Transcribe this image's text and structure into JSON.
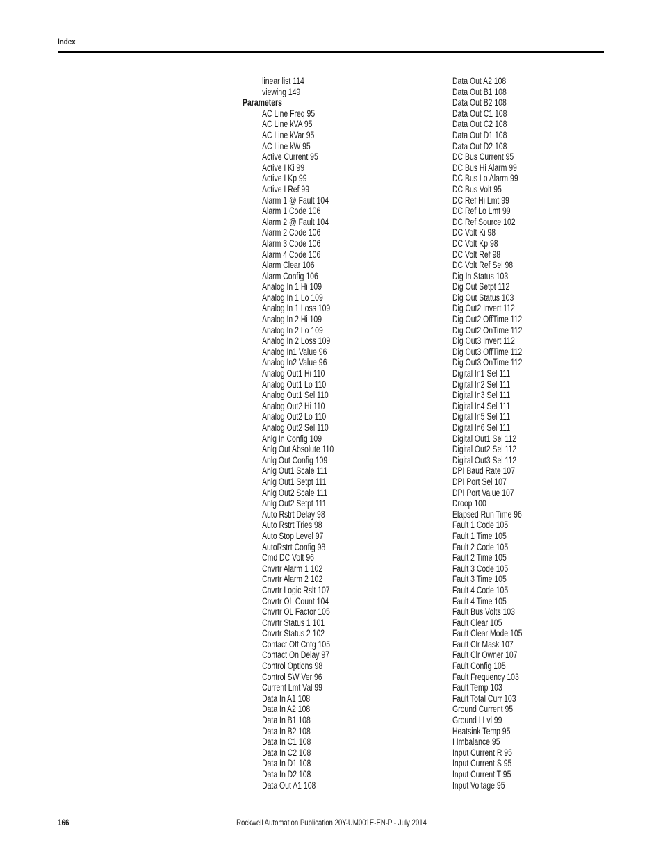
{
  "header": {
    "title": "Index"
  },
  "left_column": [
    {
      "text": "linear list 114",
      "type": "sub"
    },
    {
      "text": "viewing 149",
      "type": "sub"
    },
    {
      "text": "Parameters",
      "type": "heading"
    },
    {
      "text": "AC Line Freq 95",
      "type": "sub"
    },
    {
      "text": "AC Line kVA 95",
      "type": "sub"
    },
    {
      "text": "AC Line kVar 95",
      "type": "sub"
    },
    {
      "text": "AC Line kW 95",
      "type": "sub"
    },
    {
      "text": "Active Current 95",
      "type": "sub"
    },
    {
      "text": "Active I Ki 99",
      "type": "sub"
    },
    {
      "text": "Active I Kp 99",
      "type": "sub"
    },
    {
      "text": "Active I Ref 99",
      "type": "sub"
    },
    {
      "text": "Alarm 1 @ Fault 104",
      "type": "sub"
    },
    {
      "text": "Alarm 1 Code 106",
      "type": "sub"
    },
    {
      "text": "Alarm 2 @ Fault 104",
      "type": "sub"
    },
    {
      "text": "Alarm 2 Code 106",
      "type": "sub"
    },
    {
      "text": "Alarm 3 Code 106",
      "type": "sub"
    },
    {
      "text": "Alarm 4 Code 106",
      "type": "sub"
    },
    {
      "text": "Alarm Clear 106",
      "type": "sub"
    },
    {
      "text": "Alarm Config 106",
      "type": "sub"
    },
    {
      "text": "Analog In 1 Hi 109",
      "type": "sub"
    },
    {
      "text": "Analog In 1 Lo 109",
      "type": "sub"
    },
    {
      "text": "Analog In 1 Loss 109",
      "type": "sub"
    },
    {
      "text": "Analog In 2 Hi 109",
      "type": "sub"
    },
    {
      "text": "Analog In 2 Lo 109",
      "type": "sub"
    },
    {
      "text": "Analog In 2 Loss 109",
      "type": "sub"
    },
    {
      "text": "Analog In1 Value 96",
      "type": "sub"
    },
    {
      "text": "Analog In2 Value 96",
      "type": "sub"
    },
    {
      "text": "Analog Out1 Hi 110",
      "type": "sub"
    },
    {
      "text": "Analog Out1 Lo 110",
      "type": "sub"
    },
    {
      "text": "Analog Out1 Sel 110",
      "type": "sub"
    },
    {
      "text": "Analog Out2 Hi 110",
      "type": "sub"
    },
    {
      "text": "Analog Out2 Lo 110",
      "type": "sub"
    },
    {
      "text": "Analog Out2 Sel 110",
      "type": "sub"
    },
    {
      "text": "Anlg In Config 109",
      "type": "sub"
    },
    {
      "text": "Anlg Out Absolute 110",
      "type": "sub"
    },
    {
      "text": "Anlg Out Config 109",
      "type": "sub"
    },
    {
      "text": "Anlg Out1 Scale 111",
      "type": "sub"
    },
    {
      "text": "Anlg Out1 Setpt 111",
      "type": "sub"
    },
    {
      "text": "Anlg Out2 Scale 111",
      "type": "sub"
    },
    {
      "text": "Anlg Out2 Setpt 111",
      "type": "sub"
    },
    {
      "text": "Auto Rstrt Delay 98",
      "type": "sub"
    },
    {
      "text": "Auto Rstrt Tries 98",
      "type": "sub"
    },
    {
      "text": "Auto Stop Level 97",
      "type": "sub"
    },
    {
      "text": "AutoRstrt Config 98",
      "type": "sub"
    },
    {
      "text": "Cmd DC Volt 96",
      "type": "sub"
    },
    {
      "text": "Cnvrtr Alarm 1 102",
      "type": "sub"
    },
    {
      "text": "Cnvrtr Alarm 2 102",
      "type": "sub"
    },
    {
      "text": "Cnvrtr Logic Rslt 107",
      "type": "sub"
    },
    {
      "text": "Cnvrtr OL Count 104",
      "type": "sub"
    },
    {
      "text": "Cnvrtr OL Factor 105",
      "type": "sub"
    },
    {
      "text": "Cnvrtr Status 1 101",
      "type": "sub"
    },
    {
      "text": "Cnvrtr Status 2 102",
      "type": "sub"
    },
    {
      "text": "Contact Off Cnfg 105",
      "type": "sub"
    },
    {
      "text": "Contact On Delay 97",
      "type": "sub"
    },
    {
      "text": "Control Options 98",
      "type": "sub"
    },
    {
      "text": "Control SW Ver 96",
      "type": "sub"
    },
    {
      "text": "Current Lmt Val 99",
      "type": "sub"
    },
    {
      "text": "Data In A1 108",
      "type": "sub"
    },
    {
      "text": "Data In A2 108",
      "type": "sub"
    },
    {
      "text": "Data In B1 108",
      "type": "sub"
    },
    {
      "text": "Data In B2 108",
      "type": "sub"
    },
    {
      "text": "Data In C1 108",
      "type": "sub"
    },
    {
      "text": "Data In C2 108",
      "type": "sub"
    },
    {
      "text": "Data In D1 108",
      "type": "sub"
    },
    {
      "text": "Data In D2 108",
      "type": "sub"
    },
    {
      "text": "Data Out A1 108",
      "type": "sub"
    }
  ],
  "right_column": [
    {
      "text": "Data Out A2 108",
      "type": "sub"
    },
    {
      "text": "Data Out B1 108",
      "type": "sub"
    },
    {
      "text": "Data Out B2 108",
      "type": "sub"
    },
    {
      "text": "Data Out C1 108",
      "type": "sub"
    },
    {
      "text": "Data Out C2 108",
      "type": "sub"
    },
    {
      "text": "Data Out D1 108",
      "type": "sub"
    },
    {
      "text": "Data Out D2 108",
      "type": "sub"
    },
    {
      "text": "DC Bus Current 95",
      "type": "sub"
    },
    {
      "text": "DC Bus Hi Alarm 99",
      "type": "sub"
    },
    {
      "text": "DC Bus Lo Alarm 99",
      "type": "sub"
    },
    {
      "text": "DC Bus Volt 95",
      "type": "sub"
    },
    {
      "text": "DC Ref Hi Lmt 99",
      "type": "sub"
    },
    {
      "text": "DC Ref Lo Lmt 99",
      "type": "sub"
    },
    {
      "text": "DC Ref Source 102",
      "type": "sub"
    },
    {
      "text": "DC Volt Ki 98",
      "type": "sub"
    },
    {
      "text": "DC Volt Kp 98",
      "type": "sub"
    },
    {
      "text": "DC Volt Ref 98",
      "type": "sub"
    },
    {
      "text": "DC Volt Ref Sel 98",
      "type": "sub"
    },
    {
      "text": "Dig In Status 103",
      "type": "sub"
    },
    {
      "text": "Dig Out Setpt 112",
      "type": "sub"
    },
    {
      "text": "Dig Out Status 103",
      "type": "sub"
    },
    {
      "text": "Dig Out2 Invert 112",
      "type": "sub"
    },
    {
      "text": "Dig Out2 OffTime 112",
      "type": "sub"
    },
    {
      "text": "Dig Out2 OnTime 112",
      "type": "sub"
    },
    {
      "text": "Dig Out3 Invert 112",
      "type": "sub"
    },
    {
      "text": "Dig Out3 OffTime 112",
      "type": "sub"
    },
    {
      "text": "Dig Out3 OnTime 112",
      "type": "sub"
    },
    {
      "text": "Digital In1 Sel 111",
      "type": "sub"
    },
    {
      "text": "Digital In2 Sel 111",
      "type": "sub"
    },
    {
      "text": "Digital In3 Sel 111",
      "type": "sub"
    },
    {
      "text": "Digital In4 Sel 111",
      "type": "sub"
    },
    {
      "text": "Digital In5 Sel 111",
      "type": "sub"
    },
    {
      "text": "Digital In6 Sel 111",
      "type": "sub"
    },
    {
      "text": "Digital Out1 Sel 112",
      "type": "sub"
    },
    {
      "text": "Digital Out2 Sel 112",
      "type": "sub"
    },
    {
      "text": "Digital Out3 Sel 112",
      "type": "sub"
    },
    {
      "text": "DPI Baud Rate 107",
      "type": "sub"
    },
    {
      "text": "DPI Port Sel 107",
      "type": "sub"
    },
    {
      "text": "DPI Port Value 107",
      "type": "sub"
    },
    {
      "text": "Droop 100",
      "type": "sub"
    },
    {
      "text": "Elapsed Run Time 96",
      "type": "sub"
    },
    {
      "text": "Fault 1 Code 105",
      "type": "sub"
    },
    {
      "text": "Fault 1 Time 105",
      "type": "sub"
    },
    {
      "text": "Fault 2 Code 105",
      "type": "sub"
    },
    {
      "text": "Fault 2 Time 105",
      "type": "sub"
    },
    {
      "text": "Fault 3 Code 105",
      "type": "sub"
    },
    {
      "text": "Fault 3 Time 105",
      "type": "sub"
    },
    {
      "text": "Fault 4 Code 105",
      "type": "sub"
    },
    {
      "text": "Fault 4 Time 105",
      "type": "sub"
    },
    {
      "text": "Fault Bus Volts 103",
      "type": "sub"
    },
    {
      "text": "Fault Clear 105",
      "type": "sub"
    },
    {
      "text": "Fault Clear Mode 105",
      "type": "sub"
    },
    {
      "text": "Fault Clr Mask 107",
      "type": "sub"
    },
    {
      "text": "Fault Clr Owner 107",
      "type": "sub"
    },
    {
      "text": "Fault Config 105",
      "type": "sub"
    },
    {
      "text": "Fault Frequency 103",
      "type": "sub"
    },
    {
      "text": "Fault Temp 103",
      "type": "sub"
    },
    {
      "text": "Fault Total Curr 103",
      "type": "sub"
    },
    {
      "text": "Ground Current 95",
      "type": "sub"
    },
    {
      "text": "Ground I Lvl 99",
      "type": "sub"
    },
    {
      "text": "Heatsink Temp 95",
      "type": "sub"
    },
    {
      "text": "I Imbalance 95",
      "type": "sub"
    },
    {
      "text": "Input Current R 95",
      "type": "sub"
    },
    {
      "text": "Input Current S 95",
      "type": "sub"
    },
    {
      "text": "Input Current T 95",
      "type": "sub"
    },
    {
      "text": "Input Voltage 95",
      "type": "sub"
    }
  ],
  "footer": {
    "page_number": "166",
    "publication": "Rockwell Automation Publication 20Y-UM001E-EN-P - July 2014"
  }
}
